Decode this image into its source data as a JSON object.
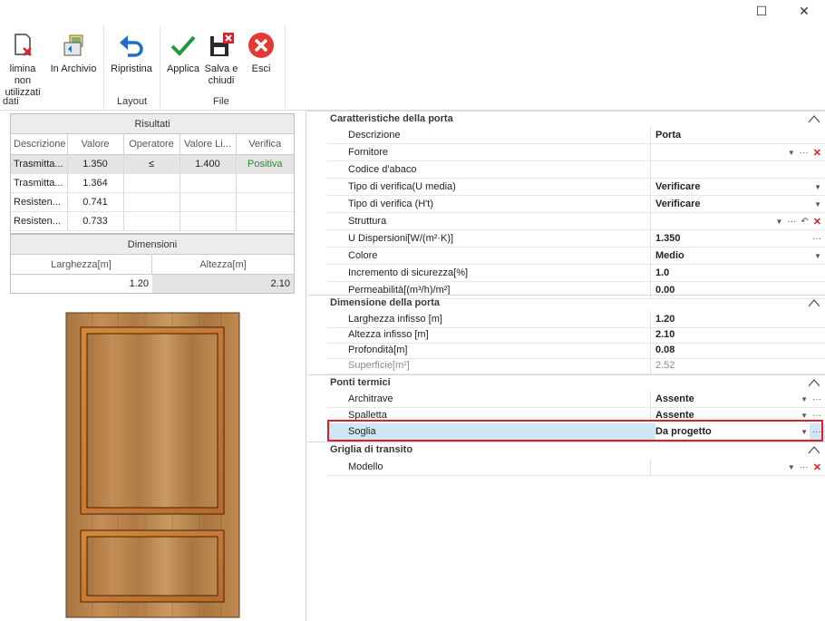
{
  "window": {
    "maximize_glyph": "☐",
    "close_glyph": "✕"
  },
  "ribbon": {
    "groups": [
      {
        "label": "dati"
      },
      {
        "label": "Layout"
      },
      {
        "label": "File"
      }
    ],
    "buttons": {
      "elimina_line1": "limina non",
      "elimina_line2": "utilizzati",
      "archivio": "In Archivio",
      "ripristina": "Ripristina",
      "applica": "Applica",
      "salva_line1": "Salva e",
      "salva_line2": "chiudi",
      "esci": "Esci"
    }
  },
  "results": {
    "title": "Risultati",
    "columns": [
      "Descrizione",
      "Valore",
      "Operatore",
      "Valore Li...",
      "Verifica"
    ],
    "rows": [
      [
        "Trasmitta...",
        "1.350",
        "≤",
        "1.400",
        "Positiva"
      ],
      [
        "Trasmitta...",
        "1.364",
        "",
        "",
        ""
      ],
      [
        "Resisten...",
        "0.741",
        "",
        "",
        ""
      ],
      [
        "Resisten...",
        "0.733",
        "",
        "",
        ""
      ]
    ]
  },
  "dimensions": {
    "title": "Dimensioni",
    "width_label": "Larghezza[m]",
    "height_label": "Altezza[m]",
    "width_value": "1.20",
    "height_value": "2.10"
  },
  "properties": {
    "cat1": {
      "title": "Caratteristiche della porta",
      "rows": [
        {
          "name": "Descrizione",
          "value": "Porta"
        },
        {
          "name": "Fornitore",
          "value": ""
        },
        {
          "name": "Codice d'abaco",
          "value": ""
        },
        {
          "name": "Tipo di verifica(U media)",
          "value": "Verificare"
        },
        {
          "name": "Tipo di verifica (H't)",
          "value": "Verificare"
        },
        {
          "name": "Struttura",
          "value": ""
        },
        {
          "name": "U Dispersioni[W/(m²·K)]",
          "value": "1.350"
        },
        {
          "name": "Colore",
          "value": "Medio"
        },
        {
          "name": "Incremento di sicurezza[%]",
          "value": "1.0"
        },
        {
          "name": "Permeabilità[(m³/h)/m²]",
          "value": "0.00"
        }
      ]
    },
    "cat2": {
      "title": "Dimensione della porta",
      "rows": [
        {
          "name": "Larghezza infisso [m]",
          "value": "1.20"
        },
        {
          "name": "Altezza infisso [m]",
          "value": "2.10"
        },
        {
          "name": "Profondità[m]",
          "value": "0.08"
        },
        {
          "name": "Superficie[m²]",
          "value": "2.52"
        }
      ]
    },
    "cat3": {
      "title": "Ponti termici",
      "rows": [
        {
          "name": "Architrave",
          "value": "Assente"
        },
        {
          "name": "Spalletta",
          "value": "Assente"
        },
        {
          "name": "Soglia",
          "value": "Da progetto"
        }
      ]
    },
    "cat4": {
      "title": "Griglia di transito",
      "rows": [
        {
          "name": "Modello",
          "value": ""
        }
      ]
    }
  },
  "colors": {
    "accent_red": "#d6222a",
    "selection": "#cfe8f8",
    "check_green": "#1f9a3a",
    "door_wood": "#b9824a"
  }
}
